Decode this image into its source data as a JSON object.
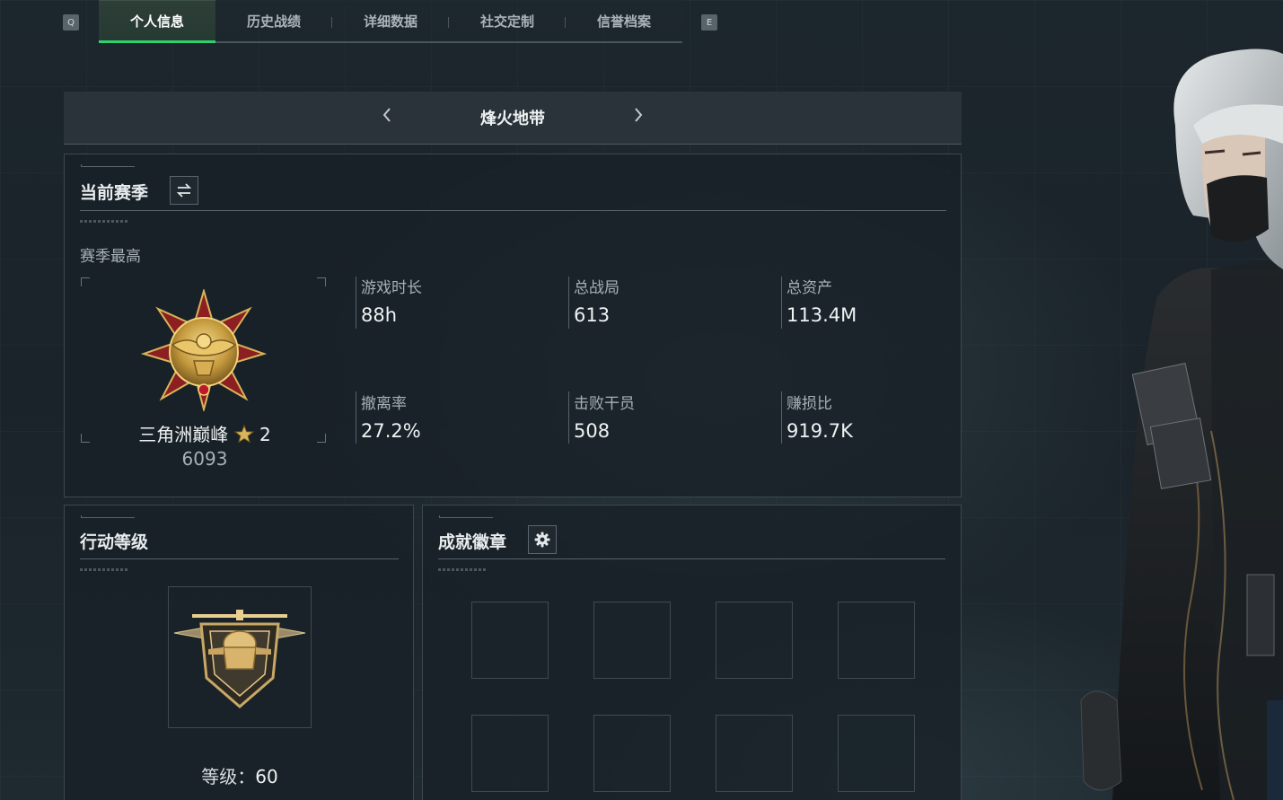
{
  "top_nav": {
    "prev_key": "Q",
    "next_key": "E",
    "tabs": [
      "个人信息",
      "历史战绩",
      "详细数据",
      "社交定制",
      "信誉档案"
    ],
    "active_tab": 0,
    "accent_color": "#2fd16f"
  },
  "mode": {
    "title": "烽火地带",
    "prev_icon": "chevron-left",
    "next_icon": "chevron-right"
  },
  "season": {
    "title": "当前赛季",
    "switch_icon": "swap-icon",
    "best_label": "赛季最高",
    "rank_name": "三角洲巅峰",
    "rank_stars": "2",
    "rank_score": "6093",
    "stats": [
      {
        "label": "游戏时长",
        "value": "88h"
      },
      {
        "label": "总战局",
        "value": "613"
      },
      {
        "label": "总资产",
        "value": "113.4M"
      },
      {
        "label": "撤离率",
        "value": "27.2%"
      },
      {
        "label": "击败干员",
        "value": "508"
      },
      {
        "label": "赚损比",
        "value": "919.7K"
      }
    ]
  },
  "action_level": {
    "title": "行动等级",
    "level_label": "等级：",
    "level_value": "60"
  },
  "achievements": {
    "title": "成就徽章",
    "settings_icon": "gear-icon",
    "slots": 8
  }
}
